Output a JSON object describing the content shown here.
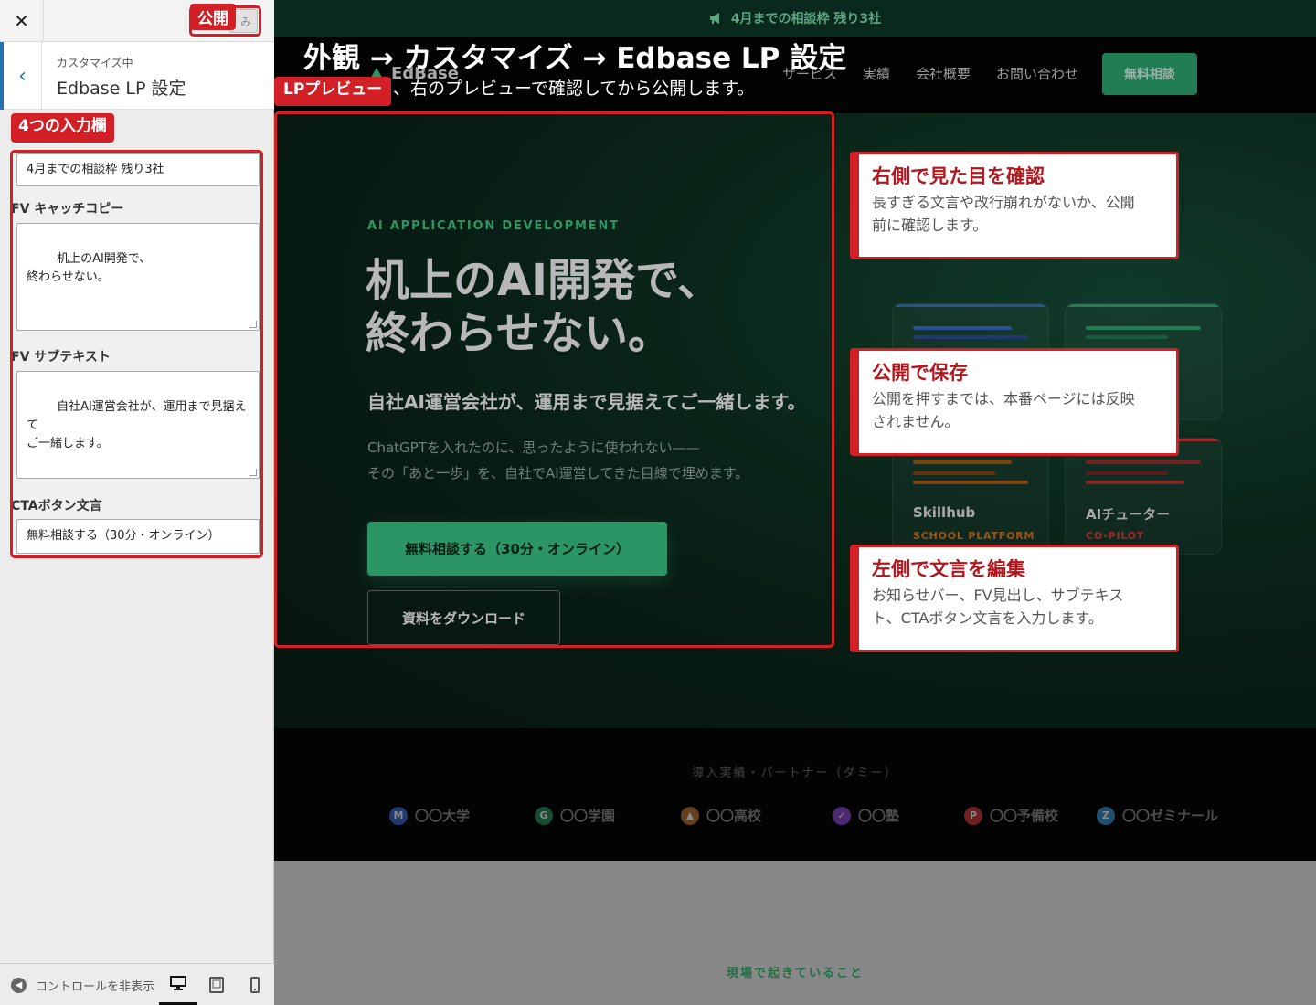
{
  "sidebar": {
    "close_glyph": "✕",
    "save_label": "み",
    "back_glyph": "‹",
    "kicker": "カスタマイズ中",
    "title": "Edbase LP 設定",
    "fields": {
      "announcement_value": "4月までの相談枠 残り3社",
      "catch_label": "FV キャッチコピー",
      "catch_value": "机上のAI開発で、\n終わらせない。",
      "subtext_label": "FV サブテキスト",
      "subtext_value": "自社AI運営会社が、運用まで見据えて\nご一緒します。",
      "cta_label": "CTAボタン文言",
      "cta_value": "無料相談する（30分・オンライン）"
    },
    "footer": {
      "hide_controls": "コントロールを非表示"
    }
  },
  "preview": {
    "announcement": "4月までの相談枠 残り3社",
    "nav": {
      "logo": "EdBase",
      "links": [
        "サービス",
        "実績",
        "会社概要",
        "お問い合わせ"
      ],
      "cta": "無料相談"
    },
    "hero": {
      "eyebrow": "AI APPLICATION DEVELOPMENT",
      "heading": "机上のAI開発で、\n終わらせない。",
      "sub": "自社AI運営会社が、運用まで見据えてご一緒します。",
      "body": "ChatGPTを入れたのに、思ったように使われない——\nその「あと一歩」を、自社でAI運営してきた目線で埋めます。",
      "cta_primary": "無料相談する（30分・オンライン）",
      "cta_secondary": "資料をダウンロード",
      "cards": [
        {
          "name": "",
          "tag": "",
          "color": "#3b6fd6"
        },
        {
          "name": "",
          "tag": "",
          "color": "#2fae74"
        },
        {
          "name": "Skillhub",
          "tag": "SCHOOL PLATFORM",
          "color": "#d9731c"
        },
        {
          "name": "AIチューター",
          "tag": "CO-PILOT",
          "color": "#d63a3a"
        }
      ]
    },
    "partners": {
      "title": "導入実績・パートナー（ダミー）",
      "items": [
        {
          "letter": "M",
          "name": "〇〇大学",
          "color": "#2f4f9a"
        },
        {
          "letter": "G",
          "name": "〇〇学園",
          "color": "#1f6b48"
        },
        {
          "letter": "▲",
          "name": "〇〇高校",
          "color": "#8a5a2b"
        },
        {
          "letter": "✓",
          "name": "〇〇塾",
          "color": "#6a3aa0"
        },
        {
          "letter": "P",
          "name": "〇〇予備校",
          "color": "#9a2f2f"
        },
        {
          "letter": "Z",
          "name": "〇〇ゼミナール",
          "color": "#2f6f9a"
        }
      ]
    },
    "next_section": "現場で起きていること"
  },
  "annotations": {
    "banner_title": "外観 → カスタマイズ → Edbase LP 設定",
    "banner_sub": "、右のプレビューで確認してから公開します。",
    "tag_publish": "公開",
    "tag_preview": "LPプレビュー",
    "tag_inputs": "4つの入力欄",
    "callouts": [
      {
        "title": "右側で見た目を確認",
        "body": "長すぎる文言や改行崩れがないか、公開\n前に確認します。"
      },
      {
        "title": "公開で保存",
        "body": "公開を押すまでは、本番ページには反映\nされません。"
      },
      {
        "title": "左側で文言を編集",
        "body": "お知らせバー、FV見出し、サブテキス\nト、CTAボタン文言を入力します。"
      }
    ]
  },
  "colors": {
    "accent_red": "#d32027",
    "brand_green": "#3ecf8e",
    "wp_blue": "#2271b1"
  }
}
